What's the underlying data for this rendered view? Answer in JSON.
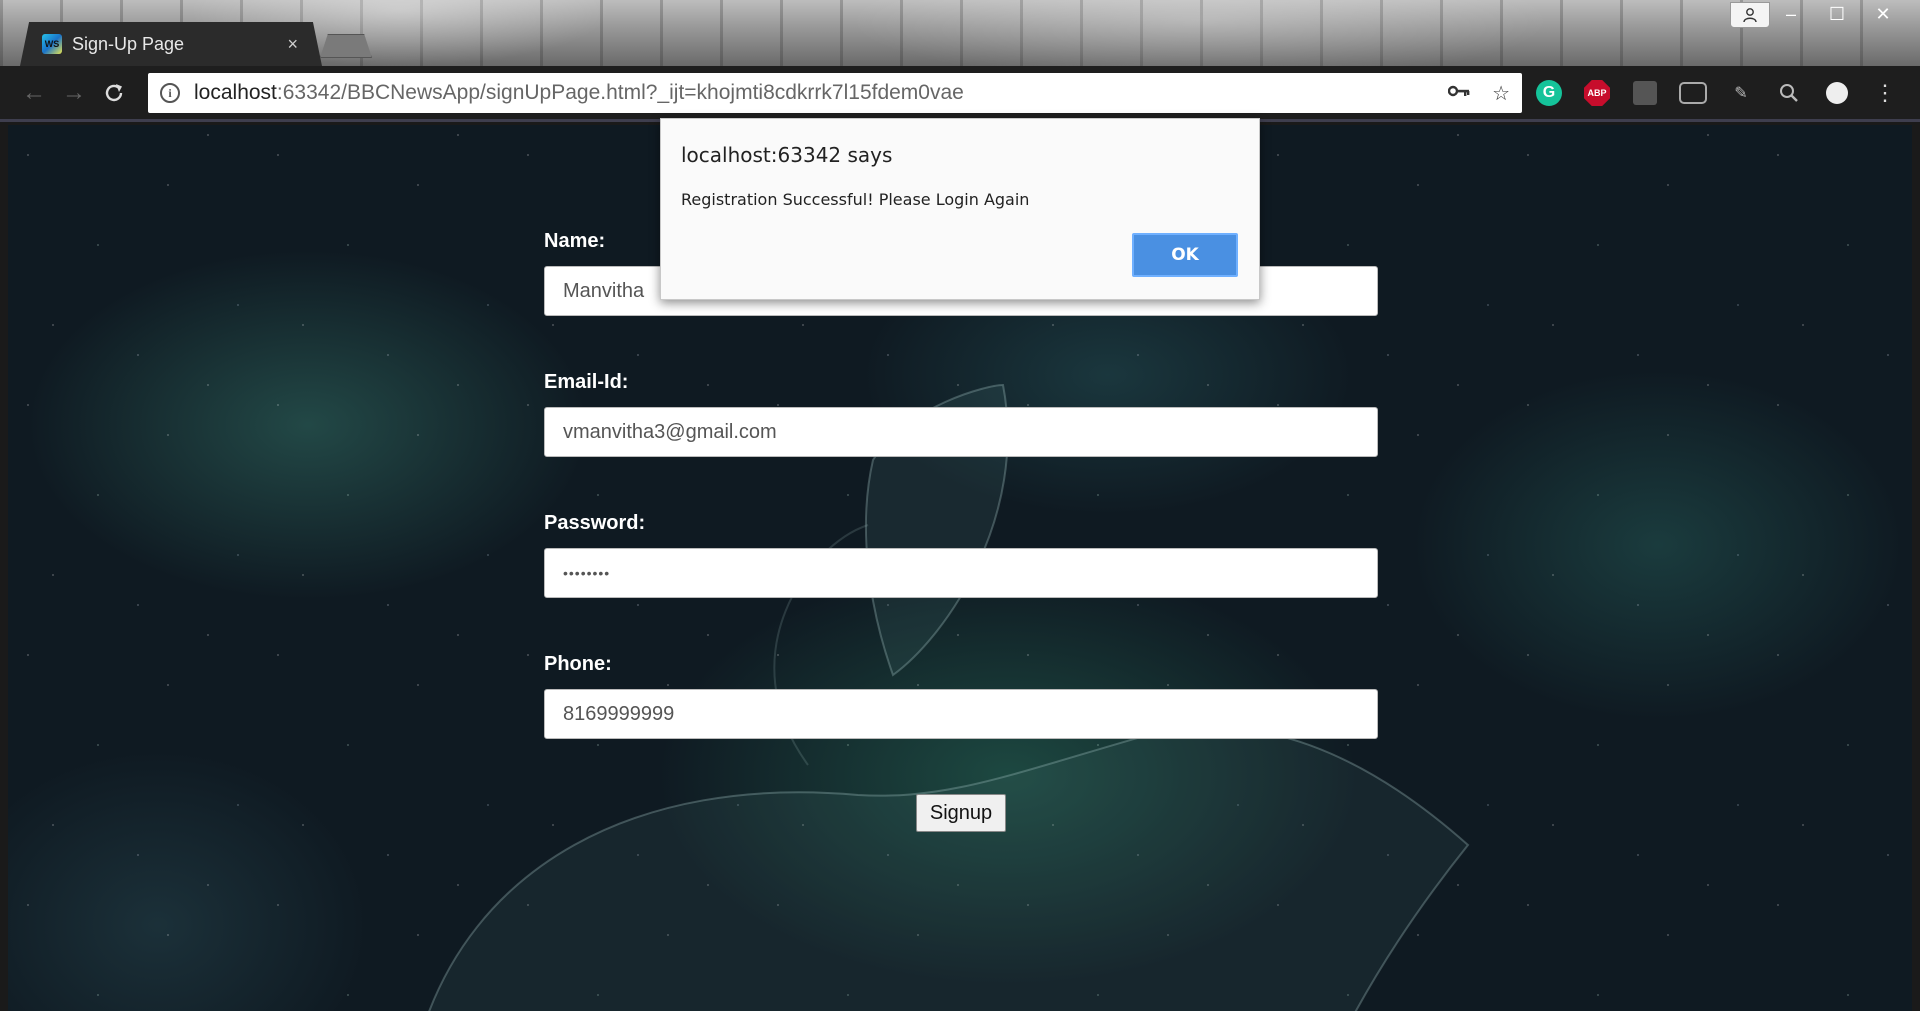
{
  "browser": {
    "tab_title": "Sign-Up Page",
    "tab_favicon_text": "WS",
    "tab_close": "×",
    "window_controls": {
      "minimize": "–",
      "maximize": "☐",
      "close": "✕"
    },
    "url_host": "localhost",
    "url_path": ":63342/BBCNewsApp/signUpPage.html?_ijt=khojmti8cdkrrk7l15fdem0vae"
  },
  "extensions": [
    {
      "name": "grammarly-icon",
      "text": "G"
    },
    {
      "name": "adblock-icon",
      "text": "ABP"
    }
  ],
  "form": {
    "name_label": "Name:",
    "name_value": "Manvitha",
    "email_label": "Email-Id:",
    "email_value": "vmanvitha3@gmail.com",
    "password_label": "Password:",
    "password_value": "••••••••",
    "phone_label": "Phone:",
    "phone_value": "8169999999",
    "signup_label": "Signup"
  },
  "alert": {
    "title": "localhost:63342 says",
    "message": "Registration Successful! Please Login Again",
    "ok_label": "OK"
  },
  "colors": {
    "alert_ok": "#4a90e2",
    "page_bg": "#0f1a22"
  }
}
